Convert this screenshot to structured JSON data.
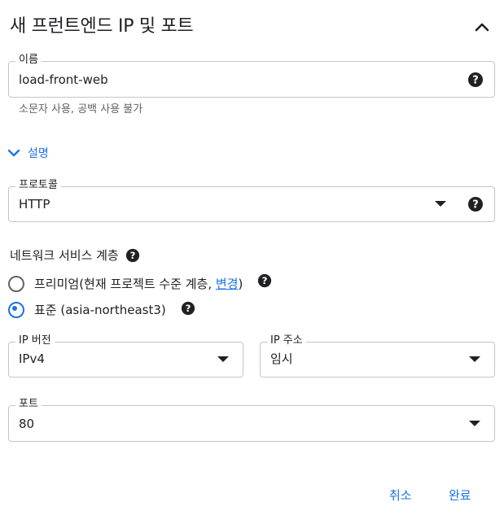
{
  "panel": {
    "title": "새 프런트엔드 IP 및 포트",
    "collapse_icon": "chevron-up-icon"
  },
  "name_field": {
    "label": "이름",
    "value": "load-front-web",
    "hint": "소문자 사용, 공백 사용 불가",
    "help_icon": "help-icon"
  },
  "description_toggle": {
    "label": "설명",
    "icon": "chevron-down-icon"
  },
  "protocol_field": {
    "label": "프로토콜",
    "value": "HTTP",
    "help_icon": "help-icon"
  },
  "network_tier": {
    "label": "네트워크 서비스 계층",
    "options": [
      {
        "label_prefix": "프리미엄(현재 프로젝트 수준 계층, ",
        "link": "변경",
        "label_suffix": ")",
        "checked": false
      },
      {
        "label": "표준 (asia-northeast3)",
        "checked": true
      }
    ]
  },
  "ip_version": {
    "label": "IP 버전",
    "value": "IPv4"
  },
  "ip_address": {
    "label": "IP 주소",
    "value": "임시"
  },
  "port": {
    "label": "포트",
    "value": "80"
  },
  "footer": {
    "cancel_label": "취소",
    "done_label": "완료"
  },
  "colors": {
    "accent": "#1a73e8",
    "border": "#c4c7c5",
    "text": "#202124",
    "hint": "#5f6368"
  }
}
